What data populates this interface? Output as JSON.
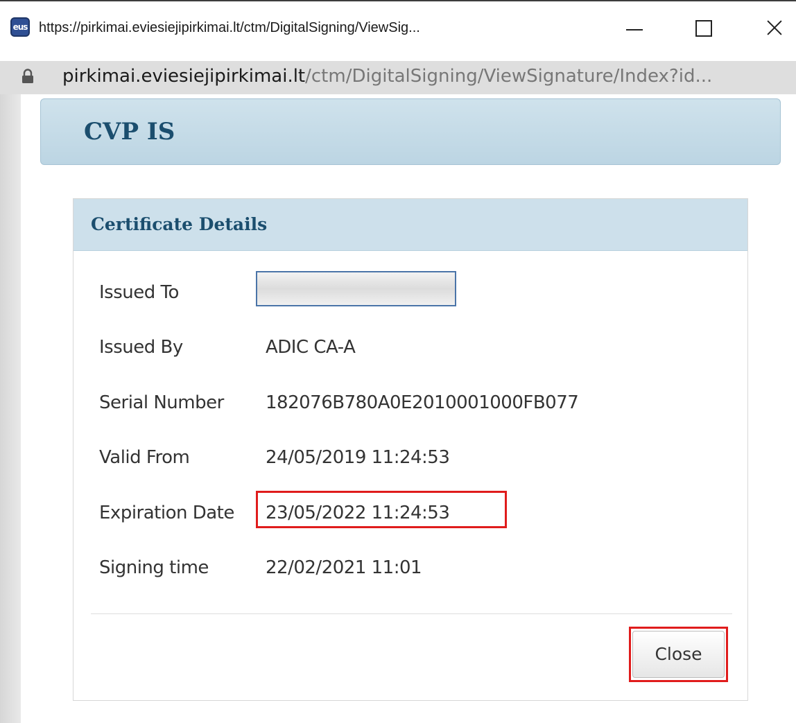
{
  "window": {
    "favicon_text": "eus",
    "title": "https://pirkimai.eviesiejipirkimai.lt/ctm/DigitalSigning/ViewSig..."
  },
  "address": {
    "host": "pirkimai.eviesiejipirkimai.lt",
    "path": "/ctm/DigitalSigning/ViewSignature/Index?id..."
  },
  "app": {
    "title": "CVP IS"
  },
  "certificate": {
    "title": "Certificate Details",
    "issued_to": {
      "label": "Issued To",
      "value": ""
    },
    "issued_by": {
      "label": "Issued By",
      "value": "ADIC CA-A"
    },
    "serial_number": {
      "label": "Serial Number",
      "value": "182076B780A0E2010001000FB077"
    },
    "valid_from": {
      "label": "Valid From",
      "value": "24/05/2019 11:24:53"
    },
    "expiration_date": {
      "label": "Expiration Date",
      "value": "23/05/2022 11:24:53"
    },
    "signing_time": {
      "label": "Signing time",
      "value": "22/02/2021 11:01"
    },
    "close_label": "Close"
  },
  "colors": {
    "header_text": "#1b4e6e",
    "highlight": "#e01c1c"
  }
}
